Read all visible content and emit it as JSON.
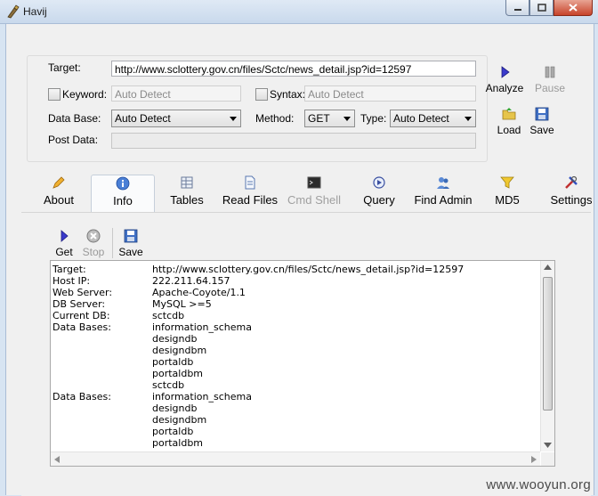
{
  "window": {
    "title": "Havij"
  },
  "form": {
    "target_label": "Target:",
    "target_value": "http://www.sclottery.gov.cn/files/Sctc/news_detail.jsp?id=12597",
    "keyword_label": "Keyword:",
    "keyword_placeholder": "Auto Detect",
    "syntax_label": "Syntax:",
    "syntax_placeholder": "Auto Detect",
    "database_label": "Data Base:",
    "database_value": "Auto Detect",
    "method_label": "Method:",
    "method_value": "GET",
    "type_label": "Type:",
    "type_value": "Auto Detect",
    "postdata_label": "Post Data:"
  },
  "actions": {
    "analyze": "Analyze",
    "pause": "Pause",
    "load": "Load",
    "save": "Save"
  },
  "tabs": [
    {
      "label": "About",
      "icon": "pencil-icon"
    },
    {
      "label": "Info",
      "icon": "info-icon"
    },
    {
      "label": "Tables",
      "icon": "table-icon"
    },
    {
      "label": "Read Files",
      "icon": "file-icon"
    },
    {
      "label": "Cmd Shell",
      "icon": "terminal-icon"
    },
    {
      "label": "Query",
      "icon": "query-icon"
    },
    {
      "label": "Find Admin",
      "icon": "users-icon"
    },
    {
      "label": "MD5",
      "icon": "funnel-icon"
    },
    {
      "label": "Settings",
      "icon": "tools-icon"
    }
  ],
  "info_toolbar": {
    "get": "Get",
    "stop": "Stop",
    "save": "Save"
  },
  "output": {
    "rows": [
      {
        "key": "Target:",
        "value": "http://www.sclottery.gov.cn/files/Sctc/news_detail.jsp?id=12597"
      },
      {
        "key": "Host IP:",
        "value": "222.211.64.157"
      },
      {
        "key": "Web Server:",
        "value": "Apache-Coyote/1.1"
      },
      {
        "key": "DB Server:",
        "value": "MySQL >=5"
      },
      {
        "key": "Current DB:",
        "value": "sctcdb"
      },
      {
        "key": "Data Bases:",
        "value": "information_schema"
      },
      {
        "key": "",
        "value": "designdb"
      },
      {
        "key": "",
        "value": "designdbm"
      },
      {
        "key": "",
        "value": "portaldb"
      },
      {
        "key": "",
        "value": "portaldbm"
      },
      {
        "key": "",
        "value": "sctcdb"
      },
      {
        "key": "Data Bases:",
        "value": "information_schema"
      },
      {
        "key": "",
        "value": "designdb"
      },
      {
        "key": "",
        "value": "designdbm"
      },
      {
        "key": "",
        "value": "portaldb"
      },
      {
        "key": "",
        "value": "portaldbm"
      }
    ]
  },
  "watermark": "www.wooyun.org"
}
